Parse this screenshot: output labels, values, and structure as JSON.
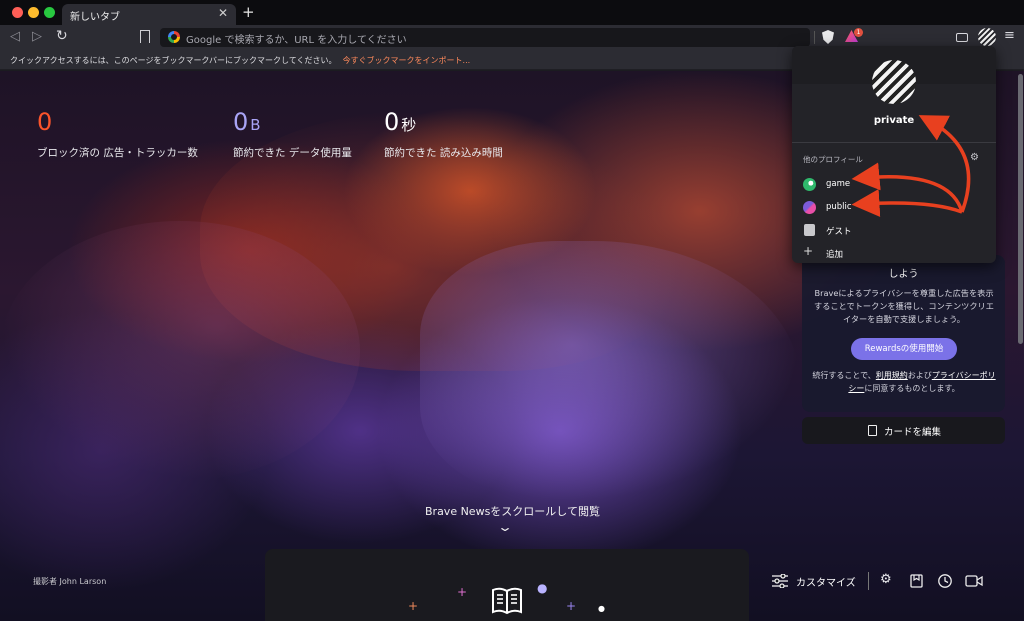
{
  "browser": {
    "tab_title": "新しいタブ",
    "tab_close": "✕",
    "new_tab": "+",
    "url_placeholder": "Google で検索するか、URL を入力してください",
    "rewards_badge": "1",
    "menu_icon": "≡",
    "bookmarks_bar_text": "クイックアクセスするには、このページをブックマークバーにブックマークしてください。",
    "bookmarks_import_link": "今すぐブックマークをインポート..."
  },
  "stats": [
    {
      "value": "0",
      "unit": "",
      "label": "ブロック済の 広告・トラッカー数",
      "color": "#fb542b"
    },
    {
      "value": "0",
      "unit": "B",
      "label": "節約できた データ使用量",
      "color": "#a9a4f6"
    },
    {
      "value": "0",
      "unit": "秒",
      "label": "節約できた 読み込み時間",
      "color": "#ffffff"
    }
  ],
  "news": {
    "hint": "Brave Newsをスクロールして閲覧",
    "chevron": "⌄"
  },
  "photo_credit": "撮影者 John Larson",
  "bottom_toolbar": {
    "customize_label": "カスタマイズ",
    "icons": [
      "customize-sliders-icon",
      "settings-gear-icon",
      "bookmarks-icon",
      "history-icon",
      "video-call-icon"
    ]
  },
  "rewards_card": {
    "title": "しよう",
    "description": "Braveによるプライバシーを尊重した広告を表示することでトークンを獲得し、コンテンツクリエイターを自動で支援しましょう。",
    "button": "Rewardsの使用開始",
    "terms_prefix": "続行することで、",
    "terms_link1": "利用規約",
    "terms_mid": "および",
    "terms_link2": "プライバシーポリシー",
    "terms_suffix": "に同意するものとします。"
  },
  "edit_cards_label": "カードを編集",
  "profile_popup": {
    "current_profile": "private",
    "section_title": "他のプロフィール",
    "items": [
      {
        "label": "game",
        "icon": "game-profile-icon"
      },
      {
        "label": "public",
        "icon": "public-profile-icon"
      },
      {
        "label": "ゲスト",
        "icon": "guest-icon"
      },
      {
        "label": "追加",
        "icon": "add-icon"
      }
    ]
  },
  "colors": {
    "annotation_arrow": "#e8401f",
    "accent_rewards": "#7b72e8"
  }
}
